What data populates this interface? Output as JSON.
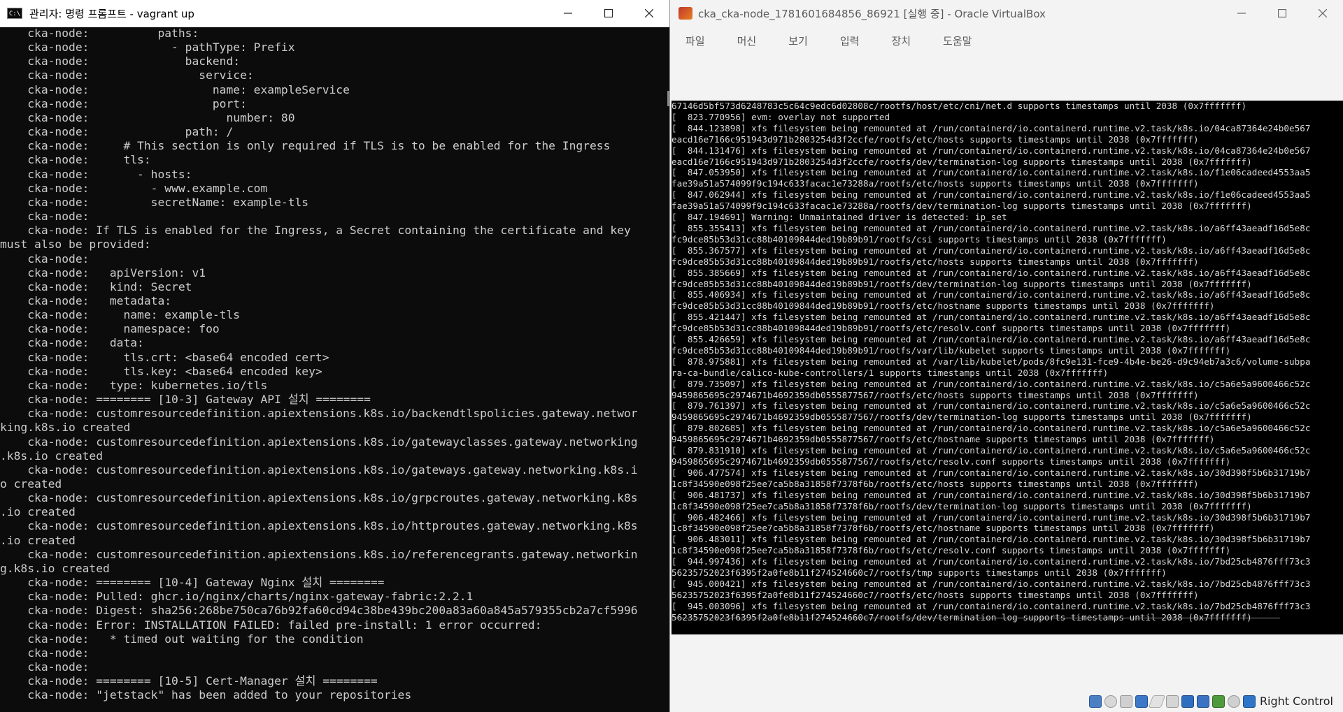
{
  "cmd_window": {
    "title": "관리자: 명령 프롬프트 - vagrant  up",
    "icon_text": "C:\\",
    "lines": [
      "    cka-node:          paths:",
      "    cka-node:            - pathType: Prefix",
      "    cka-node:              backend:",
      "    cka-node:                service:",
      "    cka-node:                  name: exampleService",
      "    cka-node:                  port:",
      "    cka-node:                    number: 80",
      "    cka-node:              path: /",
      "    cka-node:     # This section is only required if TLS is to be enabled for the Ingress",
      "    cka-node:     tls:",
      "    cka-node:       - hosts:",
      "    cka-node:         - www.example.com",
      "    cka-node:         secretName: example-tls",
      "    cka-node:",
      "    cka-node: If TLS is enabled for the Ingress, a Secret containing the certificate and key",
      "must also be provided:",
      "    cka-node:",
      "    cka-node:   apiVersion: v1",
      "    cka-node:   kind: Secret",
      "    cka-node:   metadata:",
      "    cka-node:     name: example-tls",
      "    cka-node:     namespace: foo",
      "    cka-node:   data:",
      "    cka-node:     tls.crt: <base64 encoded cert>",
      "    cka-node:     tls.key: <base64 encoded key>",
      "    cka-node:   type: kubernetes.io/tls",
      "    cka-node: ======== [10-3] Gateway API 설치 ========",
      "    cka-node: customresourcedefinition.apiextensions.k8s.io/backendtlspolicies.gateway.networ",
      "king.k8s.io created",
      "    cka-node: customresourcedefinition.apiextensions.k8s.io/gatewayclasses.gateway.networking",
      ".k8s.io created",
      "    cka-node: customresourcedefinition.apiextensions.k8s.io/gateways.gateway.networking.k8s.i",
      "o created",
      "    cka-node: customresourcedefinition.apiextensions.k8s.io/grpcroutes.gateway.networking.k8s",
      ".io created",
      "    cka-node: customresourcedefinition.apiextensions.k8s.io/httproutes.gateway.networking.k8s",
      ".io created",
      "    cka-node: customresourcedefinition.apiextensions.k8s.io/referencegrants.gateway.networkin",
      "g.k8s.io created",
      "    cka-node: ======== [10-4] Gateway Nginx 설치 ========",
      "    cka-node: Pulled: ghcr.io/nginx/charts/nginx-gateway-fabric:2.2.1",
      "    cka-node: Digest: sha256:268be750ca76b92fa60cd94c38be439bc200a83a60a845a579355cb2a7cf5996",
      "    cka-node: Error: INSTALLATION FAILED: failed pre-install: 1 error occurred:",
      "    cka-node:   * timed out waiting for the condition",
      "    cka-node:",
      "    cka-node:",
      "    cka-node: ======== [10-5] Cert-Manager 설치 ========",
      "    cka-node: \"jetstack\" has been added to your repositories"
    ]
  },
  "vbox_window": {
    "title": "cka_cka-node_1781601684856_86921 [실행 중] - Oracle VirtualBox",
    "menu": [
      "파일",
      "머신",
      "보기",
      "입력",
      "장치",
      "도움말"
    ],
    "host_key": "Right Control",
    "status_icons": [
      "hard-disk-icon",
      "optical-drive-icon",
      "floppy-icon",
      "network-icon",
      "usb-icon",
      "shared-folder-icon",
      "display-icon",
      "video-capture-icon",
      "cpu-icon",
      "mouse-integration-icon",
      "arrow-down-icon"
    ],
    "console_lines": [
      "67146d5bf573d6248783c5c64c9edc6d02808c/rootfs/host/etc/cni/net.d supports timestamps until 2038 (0x7fffffff)",
      "[  823.770956] evm: overlay not supported",
      "[  844.123898] xfs filesystem being remounted at /run/containerd/io.containerd.runtime.v2.task/k8s.io/04ca87364e24b0e567",
      "eacd16e7166c951943d971b2803254d3f2ccfe/rootfs/etc/hosts supports timestamps until 2038 (0x7fffffff)",
      "[  844.131476] xfs filesystem being remounted at /run/containerd/io.containerd.runtime.v2.task/k8s.io/04ca87364e24b0e567",
      "eacd16e7166c951943d971b2803254d3f2ccfe/rootfs/dev/termination-log supports timestamps until 2038 (0x7fffffff)",
      "[  847.053950] xfs filesystem being remounted at /run/containerd/io.containerd.runtime.v2.task/k8s.io/f1e06cadeed4553aa5",
      "fae39a51a574099f9c194c633facac1e73288a/rootfs/etc/hosts supports timestamps until 2038 (0x7fffffff)",
      "[  847.062944] xfs filesystem being remounted at /run/containerd/io.containerd.runtime.v2.task/k8s.io/f1e06cadeed4553aa5",
      "fae39a51a574099f9c194c633facac1e73288a/rootfs/dev/termination-log supports timestamps until 2038 (0x7fffffff)",
      "[  847.194691] Warning: Unmaintained driver is detected: ip_set",
      "[  855.355413] xfs filesystem being remounted at /run/containerd/io.containerd.runtime.v2.task/k8s.io/a6ff43aeadf16d5e8c",
      "fc9dce85b53d31cc88b40109844ded19b89b91/rootfs/csi supports timestamps until 2038 (0x7fffffff)",
      "[  855.367577] xfs filesystem being remounted at /run/containerd/io.containerd.runtime.v2.task/k8s.io/a6ff43aeadf16d5e8c",
      "fc9dce85b53d31cc88b40109844ded19b89b91/rootfs/etc/hosts supports timestamps until 2038 (0x7fffffff)",
      "[  855.385669] xfs filesystem being remounted at /run/containerd/io.containerd.runtime.v2.task/k8s.io/a6ff43aeadf16d5e8c",
      "fc9dce85b53d31cc88b40109844ded19b89b91/rootfs/dev/termination-log supports timestamps until 2038 (0x7fffffff)",
      "[  855.406934] xfs filesystem being remounted at /run/containerd/io.containerd.runtime.v2.task/k8s.io/a6ff43aeadf16d5e8c",
      "fc9dce85b53d31cc88b40109844ded19b89b91/rootfs/etc/hostname supports timestamps until 2038 (0x7fffffff)",
      "[  855.421447] xfs filesystem being remounted at /run/containerd/io.containerd.runtime.v2.task/k8s.io/a6ff43aeadf16d5e8c",
      "fc9dce85b53d31cc88b40109844ded19b89b91/rootfs/etc/resolv.conf supports timestamps until 2038 (0x7fffffff)",
      "[  855.426659] xfs filesystem being remounted at /run/containerd/io.containerd.runtime.v2.task/k8s.io/a6ff43aeadf16d5e8c",
      "fc9dce85b53d31cc88b40109844ded19b89b91/rootfs/var/lib/kubelet supports timestamps until 2038 (0x7fffffff)",
      "[  878.975881] xfs filesystem being remounted at /var/lib/kubelet/pods/8fc9e131-fce9-4b4e-be26-d9c94eb7a3c6/volume-subpa",
      "ra-ca-bundle/calico-kube-controllers/1 supports timestamps until 2038 (0x7fffffff)",
      "[  879.735097] xfs filesystem being remounted at /run/containerd/io.containerd.runtime.v2.task/k8s.io/c5a6e5a9600466c52c",
      "9459865695c2974671b4692359db0555877567/rootfs/etc/hosts supports timestamps until 2038 (0x7fffffff)",
      "[  879.761397] xfs filesystem being remounted at /run/containerd/io.containerd.runtime.v2.task/k8s.io/c5a6e5a9600466c52c",
      "9459865695c2974671b4692359db0555877567/rootfs/dev/termination-log supports timestamps until 2038 (0x7fffffff)",
      "[  879.802685] xfs filesystem being remounted at /run/containerd/io.containerd.runtime.v2.task/k8s.io/c5a6e5a9600466c52c",
      "9459865695c2974671b4692359db0555877567/rootfs/etc/hostname supports timestamps until 2038 (0x7fffffff)",
      "[  879.831910] xfs filesystem being remounted at /run/containerd/io.containerd.runtime.v2.task/k8s.io/c5a6e5a9600466c52c",
      "9459865695c2974671b4692359db0555877567/rootfs/etc/resolv.conf supports timestamps until 2038 (0x7fffffff)",
      "[  906.477574] xfs filesystem being remounted at /run/containerd/io.containerd.runtime.v2.task/k8s.io/30d398f5b6b31719b7",
      "1c8f34590e098f25ee7ca5b8a31858f7378f6b/rootfs/etc/hosts supports timestamps until 2038 (0x7fffffff)",
      "[  906.481737] xfs filesystem being remounted at /run/containerd/io.containerd.runtime.v2.task/k8s.io/30d398f5b6b31719b7",
      "1c8f34590e098f25ee7ca5b8a31858f7378f6b/rootfs/dev/termination-log supports timestamps until 2038 (0x7fffffff)",
      "[  906.482466] xfs filesystem being remounted at /run/containerd/io.containerd.runtime.v2.task/k8s.io/30d398f5b6b31719b7",
      "1c8f34590e098f25ee7ca5b8a31858f7378f6b/rootfs/etc/hostname supports timestamps until 2038 (0x7fffffff)",
      "[  906.483011] xfs filesystem being remounted at /run/containerd/io.containerd.runtime.v2.task/k8s.io/30d398f5b6b31719b7",
      "1c8f34590e098f25ee7ca5b8a31858f7378f6b/rootfs/etc/resolv.conf supports timestamps until 2038 (0x7fffffff)",
      "[  944.997436] xfs filesystem being remounted at /run/containerd/io.containerd.runtime.v2.task/k8s.io/7bd25cb4876fff73c3",
      "56235752023f6395f2a0fe8b11f274524660c7/rootfs/tmp supports timestamps until 2038 (0x7fffffff)",
      "[  945.000421] xfs filesystem being remounted at /run/containerd/io.containerd.runtime.v2.task/k8s.io/7bd25cb4876fff73c3",
      "56235752023f6395f2a0fe8b11f274524660c7/rootfs/etc/hosts supports timestamps until 2038 (0x7fffffff)",
      "[  945.003096] xfs filesystem being remounted at /run/containerd/io.containerd.runtime.v2.task/k8s.io/7bd25cb4876fff73c3",
      "56235752023f6395f2a0fe8b11f274524660c7/rootfs/dev/termination-log supports timestamps until 2038 (0x7fffffff)"
    ]
  }
}
